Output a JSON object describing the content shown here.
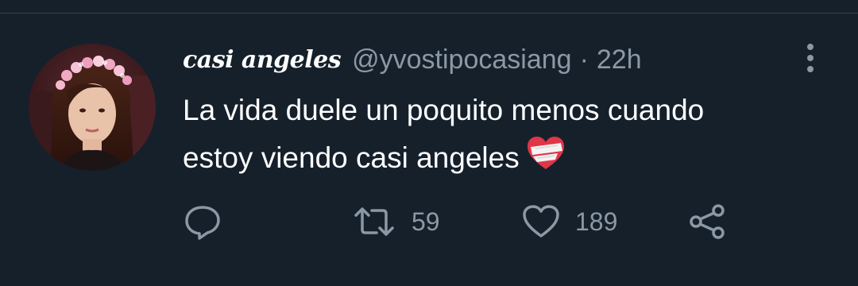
{
  "tweet": {
    "display_name": "casi angeles",
    "handle": "@yvostipocasiang",
    "separator": "·",
    "timestamp": "22h",
    "text_lines": [
      "La vida duele un poquito menos cuando",
      "estoy viendo casi angeles"
    ],
    "emoji": "mending-heart",
    "avatar": "profile-photo-girl-with-flower-crown"
  },
  "actions": {
    "reply": {
      "icon": "reply-icon",
      "count": ""
    },
    "retweet": {
      "icon": "retweet-icon",
      "count": "59"
    },
    "like": {
      "icon": "heart-icon",
      "count": "189"
    },
    "share": {
      "icon": "share-icon",
      "count": ""
    }
  },
  "colors": {
    "background": "#15202b",
    "divider": "#38444d",
    "secondary_text": "#8b98a5",
    "primary_text": "#ffffff",
    "heart_red": "#e0364a"
  }
}
